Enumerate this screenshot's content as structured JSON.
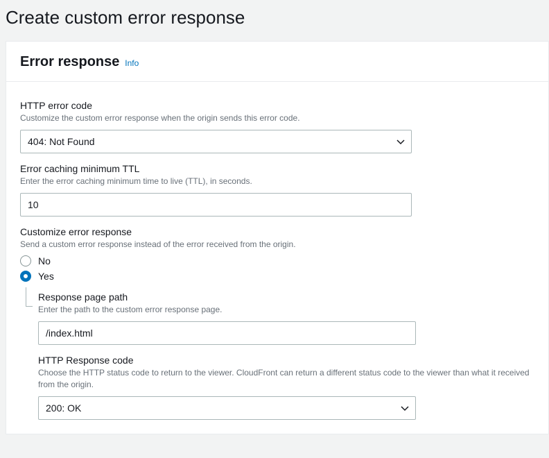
{
  "page": {
    "title": "Create custom error response"
  },
  "panel": {
    "title": "Error response",
    "info_label": "Info"
  },
  "fields": {
    "http_error_code": {
      "label": "HTTP error code",
      "hint": "Customize the custom error response when the origin sends this error code.",
      "value": "404: Not Found"
    },
    "ttl": {
      "label": "Error caching minimum TTL",
      "hint": "Enter the error caching minimum time to live (TTL), in seconds.",
      "value": "10"
    },
    "customize": {
      "label": "Customize error response",
      "hint": "Send a custom error response instead of the error received from the origin.",
      "options": {
        "no": "No",
        "yes": "Yes"
      },
      "selected": "yes"
    },
    "response_path": {
      "label": "Response page path",
      "hint": "Enter the path to the custom error response page.",
      "value": "/index.html"
    },
    "http_response_code": {
      "label": "HTTP Response code",
      "hint": "Choose the HTTP status code to return to the viewer. CloudFront can return a different status code to the viewer than what it received from the origin.",
      "value": "200: OK"
    }
  }
}
